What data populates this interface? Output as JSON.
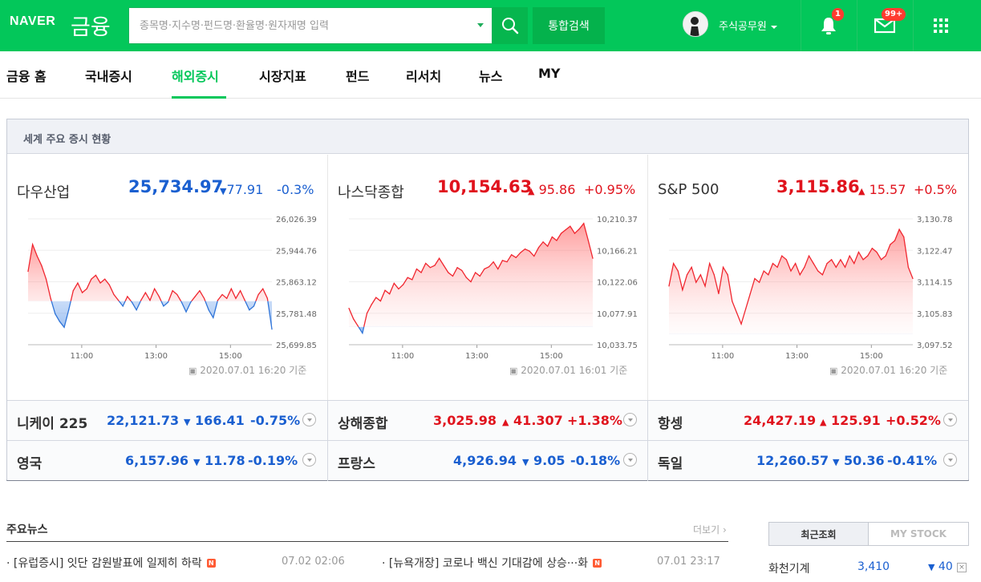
{
  "header": {
    "brand": "NAVER",
    "service": "금융",
    "search_placeholder": "종목명·지수명·펀드명·환율명·원자재명 입력",
    "total_search_label": "통합검색",
    "username": "주식공무원",
    "notification_count": "1",
    "mail_count": "99+"
  },
  "nav": {
    "items": [
      {
        "label": "금융 홈"
      },
      {
        "label": "국내증시"
      },
      {
        "label": "해외증시"
      },
      {
        "label": "시장지표"
      },
      {
        "label": "펀드"
      },
      {
        "label": "리서치"
      },
      {
        "label": "뉴스"
      },
      {
        "label": "MY"
      }
    ],
    "active": "해외증시"
  },
  "panel": {
    "title": "세계 주요 증시 현황"
  },
  "cards": [
    {
      "name": "다우산업",
      "value": "25,734.97",
      "change": "77.91",
      "pct": "-0.3%",
      "direction": "down",
      "stamp": "2020.07.01 16:20 기준"
    },
    {
      "name": "나스닥종합",
      "value": "10,154.63",
      "change": "95.86",
      "pct": "+0.95%",
      "direction": "up",
      "stamp": "2020.07.01 16:01 기준"
    },
    {
      "name": "S&P 500",
      "value": "3,115.86",
      "change": "15.57",
      "pct": "+0.5%",
      "direction": "up",
      "stamp": "2020.07.01 16:20 기준"
    }
  ],
  "chart_data": [
    {
      "type": "area",
      "title": "다우산업",
      "x_ticks": [
        "11:00",
        "13:00",
        "15:00"
      ],
      "y_ticks": [
        "26,026.39",
        "25,944.76",
        "25,863.12",
        "25,781.48",
        "25,699.85"
      ],
      "ylim": [
        25699.85,
        26026.39
      ],
      "baseline": 25812.88,
      "y": [
        25890,
        25960,
        25930,
        25905,
        25870,
        25820,
        25780,
        25760,
        25745,
        25790,
        25840,
        25860,
        25835,
        25845,
        25870,
        25880,
        25860,
        25870,
        25855,
        25830,
        25815,
        25800,
        25825,
        25810,
        25790,
        25815,
        25835,
        25815,
        25845,
        25825,
        25800,
        25810,
        25840,
        25830,
        25810,
        25785,
        25810,
        25825,
        25840,
        25820,
        25790,
        25770,
        25815,
        25830,
        25820,
        25845,
        25820,
        25840,
        25815,
        25790,
        25800,
        25830,
        25845,
        25820,
        25740
      ]
    },
    {
      "type": "area",
      "title": "나스닥종합",
      "x_ticks": [
        "11:00",
        "13:00",
        "15:00"
      ],
      "y_ticks": [
        "10,210.37",
        "10,166.21",
        "10,122.06",
        "10,077.91",
        "10,033.75"
      ],
      "ylim": [
        10033.75,
        10210.37
      ],
      "baseline": 10058.77,
      "y": [
        10085,
        10070,
        10060,
        10050,
        10078,
        10090,
        10100,
        10095,
        10110,
        10105,
        10120,
        10112,
        10118,
        10128,
        10125,
        10140,
        10135,
        10148,
        10142,
        10145,
        10155,
        10145,
        10135,
        10130,
        10142,
        10138,
        10128,
        10122,
        10135,
        10130,
        10140,
        10143,
        10150,
        10140,
        10152,
        10150,
        10160,
        10156,
        10163,
        10168,
        10165,
        10158,
        10170,
        10178,
        10172,
        10185,
        10180,
        10190,
        10195,
        10200,
        10190,
        10196,
        10204,
        10180,
        10155
      ]
    },
    {
      "type": "area",
      "title": "S&P 500",
      "x_ticks": [
        "11:00",
        "13:00",
        "15:00"
      ],
      "y_ticks": [
        "3,130.78",
        "3,122.47",
        "3,114.15",
        "3,105.83",
        "3,097.52"
      ],
      "ylim": [
        3097.52,
        3130.78
      ],
      "baseline": 3100.29,
      "y": [
        3113,
        3119,
        3117,
        3112,
        3116,
        3118,
        3114,
        3116,
        3113,
        3119,
        3116,
        3111,
        3118,
        3116,
        3109,
        3106,
        3103,
        3107,
        3111,
        3115,
        3114,
        3117,
        3116,
        3119,
        3118,
        3121,
        3120,
        3117,
        3119,
        3116,
        3118,
        3121,
        3119,
        3117,
        3116,
        3119,
        3120,
        3118,
        3120,
        3118,
        3121,
        3119,
        3122,
        3120,
        3121,
        3123,
        3122,
        3120,
        3121,
        3124,
        3125,
        3128,
        3126,
        3118,
        3115
      ]
    }
  ],
  "rows": [
    [
      {
        "name": "니케이 225",
        "value": "22,121.73",
        "change": "166.41",
        "pct": "-0.75%",
        "direction": "down"
      },
      {
        "name": "상해종합",
        "value": "3,025.98",
        "change": "41.307",
        "pct": "+1.38%",
        "direction": "up"
      },
      {
        "name": "항셍",
        "value": "24,427.19",
        "change": "125.91",
        "pct": "+0.52%",
        "direction": "up"
      }
    ],
    [
      {
        "name": "영국",
        "value": "6,157.96",
        "change": "11.78",
        "pct": "-0.19%",
        "direction": "down"
      },
      {
        "name": "프랑스",
        "value": "4,926.94",
        "change": "9.05",
        "pct": "-0.18%",
        "direction": "down"
      },
      {
        "name": "독일",
        "value": "12,260.57",
        "change": "50.36",
        "pct": "-0.41%",
        "direction": "down"
      }
    ]
  ],
  "news": {
    "title": "주요뉴스",
    "more_label": "더보기",
    "items": [
      {
        "text": "[유럽증시] 잇단 감원발표에 일제히 하락",
        "time": "07.02 02:06"
      },
      {
        "text": "[뉴욕개장] 코로나 백신 기대감에 상승···화",
        "time": "07.01 23:17"
      }
    ]
  },
  "sidebar": {
    "tab_recent": "최근조회",
    "tab_mystock": "MY STOCK",
    "items": [
      {
        "name": "화천기계",
        "value": "3,410",
        "change": "40"
      }
    ]
  },
  "colors": {
    "brand": "#03c75a",
    "up": "#e0131d",
    "down": "#1a5fd0"
  }
}
